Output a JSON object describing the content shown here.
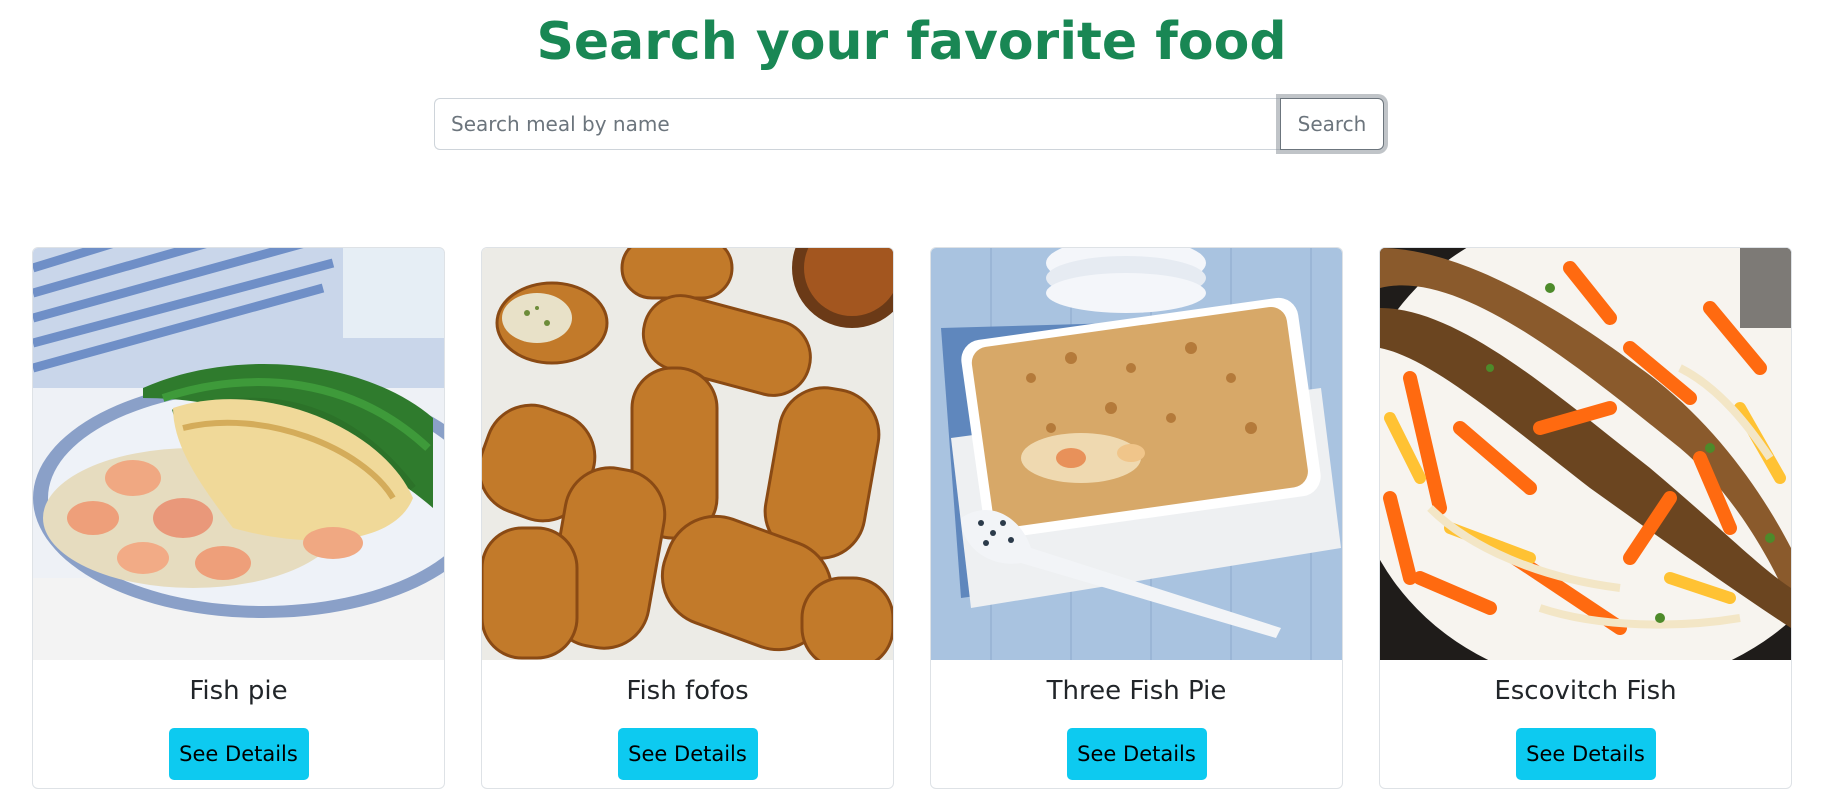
{
  "header": {
    "title": "Search your favorite food"
  },
  "search": {
    "placeholder": "Search meal by name",
    "value": "",
    "button_label": "Search"
  },
  "meals": [
    {
      "name": "Fish pie",
      "button_label": "See Details"
    },
    {
      "name": "Fish fofos",
      "button_label": "See Details"
    },
    {
      "name": "Three Fish Pie",
      "button_label": "See Details"
    },
    {
      "name": "Escovitch Fish",
      "button_label": "See Details"
    }
  ],
  "colors": {
    "title": "#198754",
    "details_button": "#0dcaf0",
    "search_button_border": "#6c757d"
  }
}
